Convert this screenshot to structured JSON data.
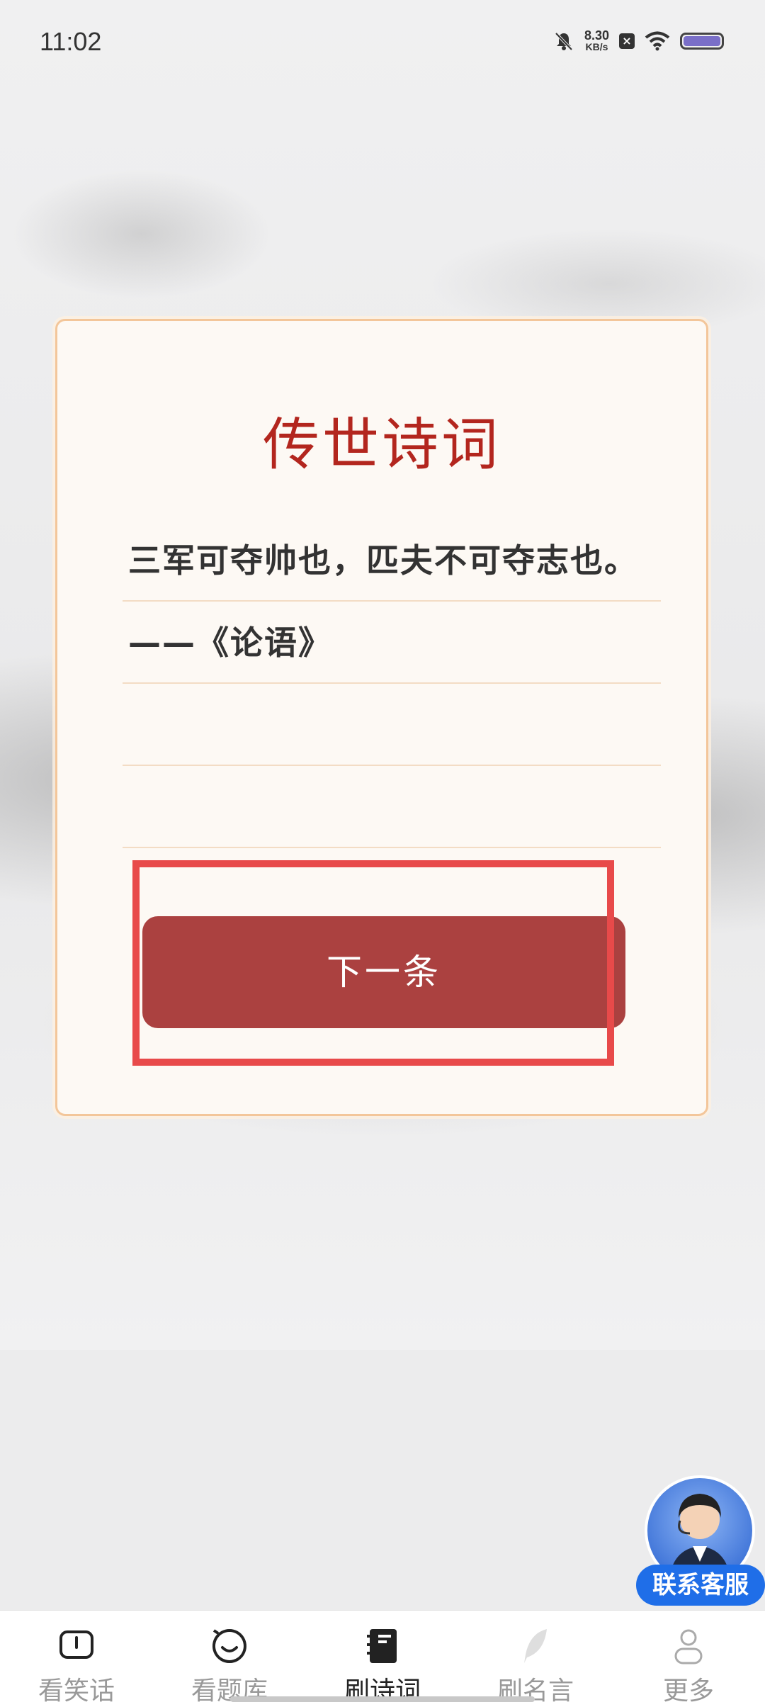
{
  "status_bar": {
    "time": "11:02",
    "speed_value": "8.30",
    "speed_unit": "KB/s",
    "icons": [
      "bell-muted-icon",
      "sim-x-icon",
      "wifi-icon",
      "battery-icon"
    ]
  },
  "card": {
    "title": "传世诗词",
    "verse": "三军可夺帅也，匹夫不可夺志也。——《论语》",
    "next_button": "下一条"
  },
  "customer_service": {
    "label": "联系客服"
  },
  "bottom_nav": {
    "items": [
      {
        "label": "看笑话",
        "icon": "joke-icon",
        "active": false
      },
      {
        "label": "看题库",
        "icon": "smile-icon",
        "active": false
      },
      {
        "label": "刷诗词",
        "icon": "book-icon",
        "active": true
      },
      {
        "label": "刷名言",
        "icon": "feather-icon",
        "active": false
      },
      {
        "label": "更多",
        "icon": "person-icon",
        "active": false
      }
    ]
  },
  "colors": {
    "accent_red": "#b3261e",
    "button_red": "#ab4140",
    "highlight": "#e84a4a",
    "cs_blue": "#1f6ee8"
  }
}
